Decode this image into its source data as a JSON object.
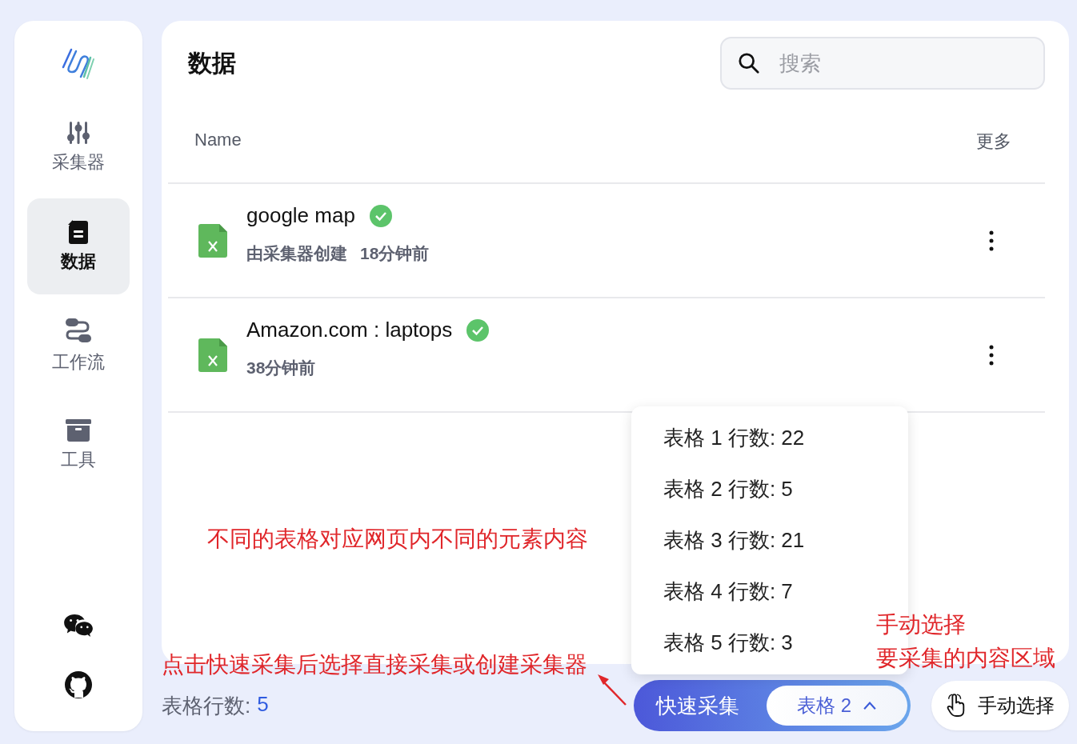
{
  "sidebar": {
    "items": [
      {
        "kind": "collector",
        "label": "采集器",
        "selected": false
      },
      {
        "kind": "data",
        "label": "数据",
        "selected": true
      },
      {
        "kind": "workflow",
        "label": "工作流",
        "selected": false
      },
      {
        "kind": "tools",
        "label": "工具",
        "selected": false
      }
    ]
  },
  "main": {
    "title": "数据",
    "search": {
      "placeholder": "搜索"
    },
    "table": {
      "columns": [
        "Name",
        "更多"
      ],
      "rows": [
        {
          "name": "google map",
          "verified": true,
          "meta": [
            "由采集器创建",
            "18分钟前"
          ]
        },
        {
          "name": "Amazon.com : laptops",
          "verified": true,
          "meta": [
            "38分钟前"
          ]
        }
      ]
    }
  },
  "dropdown": {
    "items": [
      "表格 1 行数: 22",
      "表格 2 行数: 5",
      "表格 3 行数: 21",
      "表格 4 行数: 7",
      "表格 5 行数: 3"
    ]
  },
  "bottom_bar": {
    "row_count_label": "表格行数:",
    "row_count": "5",
    "quick_collect": "快速采集",
    "table_picker": "表格 2",
    "manual_select": "手动选择"
  },
  "annotations": [
    "不同的表格对应网页内不同的元素内容",
    "点击快速采集后选择直接采集或创建采集器",
    "手动选择",
    "要采集的内容区域"
  ]
}
